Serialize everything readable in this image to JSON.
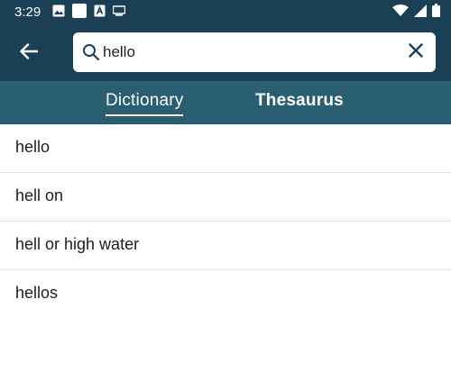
{
  "status_bar": {
    "time": "3:29",
    "left_icons": [
      "image-icon",
      "square-icon",
      "notification-icon",
      "cast-icon"
    ],
    "right_icons": [
      "wifi-icon",
      "signal-icon",
      "battery-icon"
    ]
  },
  "toolbar": {
    "back_icon": "arrow-left-icon",
    "search_icon": "search-icon",
    "clear_icon": "close-icon"
  },
  "search": {
    "value": "hello"
  },
  "tabs": [
    {
      "label": "Dictionary",
      "active": true
    },
    {
      "label": "Thesaurus",
      "active": false
    }
  ],
  "results": [
    {
      "text": "hello"
    },
    {
      "text": "hell on"
    },
    {
      "text": "hell or high water"
    },
    {
      "text": "hellos"
    }
  ],
  "colors": {
    "header": "#1b3f55",
    "tab_bar": "#2a5e72",
    "text": "#1e1e1e",
    "accent_icon": "#1b3f55"
  }
}
